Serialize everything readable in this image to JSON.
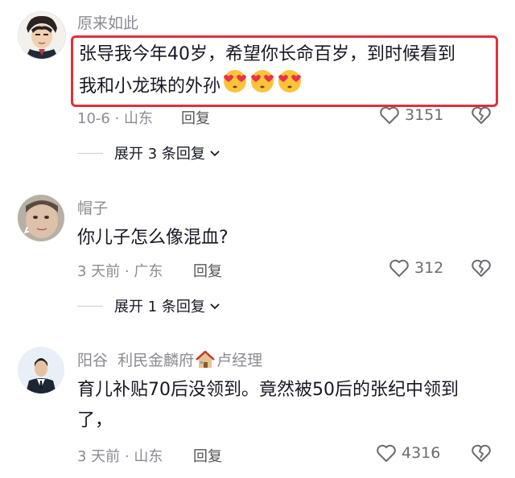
{
  "comments": [
    {
      "username": "原来如此",
      "text_line1": "张导我今年40岁，希望你长命百岁，到时候看到",
      "text_line2": "我和小龙珠的外孙",
      "emojis": [
        "heart-eyes-emoji",
        "heart-eyes-emoji",
        "heart-eyes-emoji"
      ],
      "meta": "10-6 · 山东",
      "reply_label": "回复",
      "likes": "3151",
      "expand_label": "展开 3 条回复"
    },
    {
      "username": "帽子",
      "text": "你儿子怎么像混血?",
      "meta": "3 天前 · 广东",
      "reply_label": "回复",
      "likes": "312",
      "expand_label": "展开 1 条回复"
    },
    {
      "username": "阳谷  利民金麟府",
      "username_suffix": "卢经理",
      "house_icon": "house-emoji",
      "text_line1": "育儿补贴70后没领到。竟然被50后的张纪中领到",
      "text_line2": "了，",
      "meta": "3 天前 · 山东",
      "reply_label": "回复",
      "likes": "4316"
    }
  ],
  "colors": {
    "highlight": "#e0303a",
    "muted": "#8a8b91",
    "text": "#161823"
  }
}
